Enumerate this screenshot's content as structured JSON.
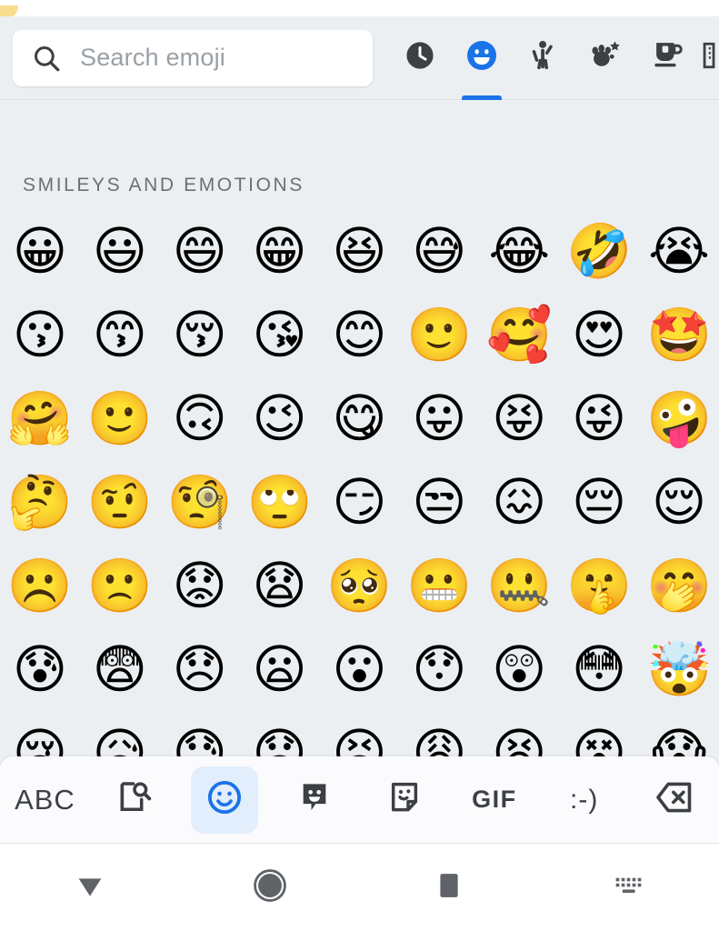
{
  "search": {
    "placeholder": "Search emoji",
    "value": "",
    "icon": "search-icon"
  },
  "category_tabs": [
    {
      "id": "recent",
      "icon": "clock-icon",
      "label": "Recently used",
      "selected": false
    },
    {
      "id": "smileys",
      "icon": "smiley-icon",
      "label": "Smileys and emotions",
      "selected": true
    },
    {
      "id": "people",
      "icon": "person-wave-icon",
      "label": "People",
      "selected": false
    },
    {
      "id": "nature",
      "icon": "animals-nature-icon",
      "label": "Animals and nature",
      "selected": false
    },
    {
      "id": "food",
      "icon": "food-drink-icon",
      "label": "Food and drink",
      "selected": false
    },
    {
      "id": "travel",
      "icon": "travel-places-icon",
      "label": "Travel and places",
      "selected": false
    }
  ],
  "section": {
    "title": "SMILEYS AND EMOTIONS"
  },
  "emoji_rows": [
    [
      "😀",
      "😃",
      "😄",
      "😁",
      "😆",
      "😅",
      "😂",
      "🤣",
      "😭"
    ],
    [
      "😗",
      "😙",
      "😚",
      "😘",
      "😊",
      "🙂",
      "🥰",
      "😍",
      "🤩"
    ],
    [
      "🤗",
      "🙂",
      "🙃",
      "😉",
      "😋",
      "😛",
      "😝",
      "😜",
      "🤪"
    ],
    [
      "🤔",
      "🤨",
      "🧐",
      "🙄",
      "😏",
      "😒",
      "😖",
      "😔",
      "😌"
    ],
    [
      "☹️",
      "🙁",
      "😟",
      "😧",
      "🥺",
      "😬",
      "🤐",
      "🤫",
      "🤭"
    ],
    [
      "😰",
      "😨",
      "😞",
      "😦",
      "😮",
      "😯",
      "😲",
      "😳",
      "🤯"
    ],
    [
      "😢",
      "😥",
      "😓",
      "😞",
      "😣",
      "😩",
      "😫",
      "😵",
      "😱"
    ]
  ],
  "keyboard_toolbar": [
    {
      "id": "abc",
      "icon": "abc-icon",
      "label": "ABC",
      "active": false
    },
    {
      "id": "search",
      "icon": "document-search-icon",
      "label": "",
      "active": false
    },
    {
      "id": "emoji",
      "icon": "smiley-outline-icon",
      "label": "",
      "active": true
    },
    {
      "id": "emoji-kitchen",
      "icon": "emoji-sticker-icon",
      "label": "",
      "active": false
    },
    {
      "id": "stickers",
      "icon": "sticker-icon",
      "label": "",
      "active": false
    },
    {
      "id": "gif",
      "icon": "gif-icon",
      "label": "GIF",
      "active": false
    },
    {
      "id": "kaomoji",
      "icon": "kaomoji-icon",
      "label": ":-)",
      "active": false
    },
    {
      "id": "backspace",
      "icon": "backspace-icon",
      "label": "",
      "active": false
    }
  ],
  "nav_bar": [
    {
      "id": "back",
      "icon": "back-triangle-icon"
    },
    {
      "id": "home",
      "icon": "home-circle-icon"
    },
    {
      "id": "recents",
      "icon": "recents-square-icon"
    },
    {
      "id": "ime-switch",
      "icon": "keyboard-switch-icon"
    }
  ],
  "colors": {
    "accent": "#1a73e8",
    "accent_bg": "#e3eefc",
    "background": "#eceff1",
    "toolbar_bg": "#fbfbfd",
    "icon_dark": "#3c4043",
    "text_muted": "#6b7074",
    "placeholder": "#9aa0a6"
  }
}
